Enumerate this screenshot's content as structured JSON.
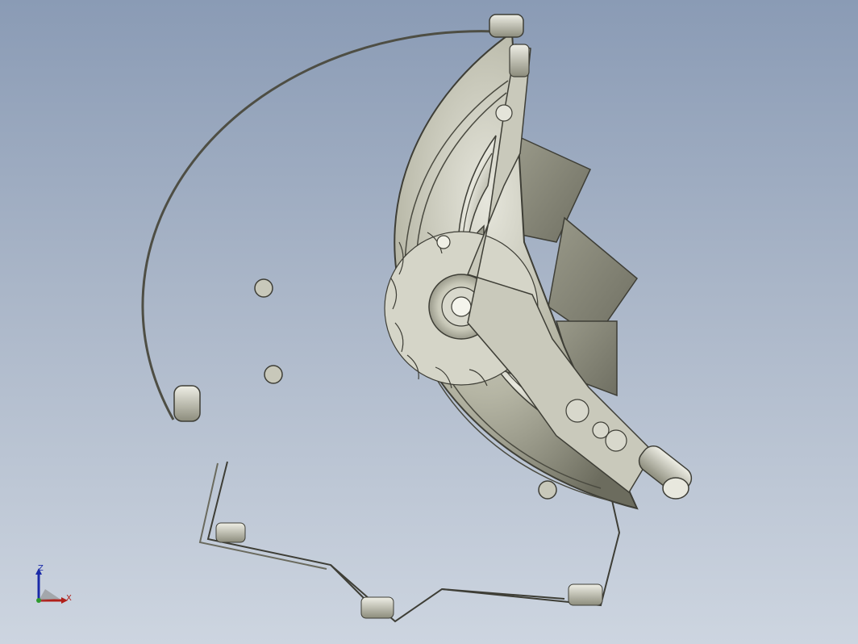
{
  "viewport": {
    "background_top": "#8a9bb5",
    "background_bottom": "#cdd5e0",
    "model_color": "#b9b9a8"
  },
  "triad": {
    "z_label": "Z",
    "x_label": "X",
    "z_color": "#1a2aa8",
    "x_color": "#b0201a",
    "y_color": "#2e9a2e"
  }
}
